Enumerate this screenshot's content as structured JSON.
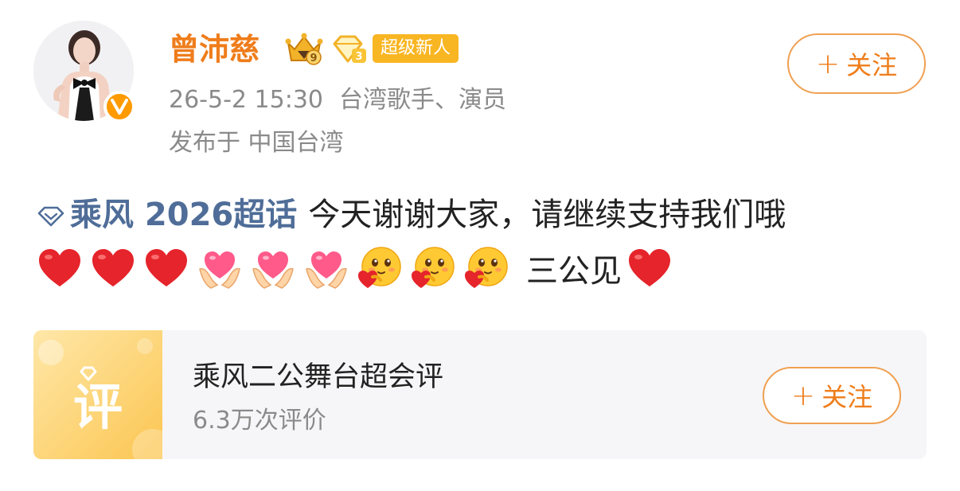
{
  "author": {
    "name": "曾沛慈",
    "crown_badge_level": "9",
    "diamond_badge_level": "3",
    "tag": "超级新人",
    "avatar_icon": "avatar-photo",
    "verified_icon": "v-verified-icon"
  },
  "post_meta": {
    "timestamp": "26-5-2 15:30",
    "description": "台湾歌手、演员",
    "location": "发布于 中国台湾"
  },
  "follow_button": {
    "plus": "+",
    "label": "关注"
  },
  "post": {
    "topic": "乘风 2026超话",
    "text": "今天谢谢大家，请继续支持我们哦",
    "tail_text": "三公见",
    "emojis": [
      "red-heart",
      "red-heart",
      "red-heart",
      "hands-heart",
      "hands-heart",
      "hands-heart",
      "hug-face",
      "hug-face",
      "hug-face",
      "red-heart"
    ]
  },
  "card": {
    "thumb_char": "评",
    "title": "乘风二公舞台超会评",
    "subtitle": "6.3万次评价",
    "follow": {
      "plus": "+",
      "label": "关注"
    }
  },
  "colors": {
    "accent": "#ef7d1b",
    "topic_blue": "#4f6d98",
    "badge_yellow": "#f9b623",
    "gray_text": "#8a8a8a"
  }
}
